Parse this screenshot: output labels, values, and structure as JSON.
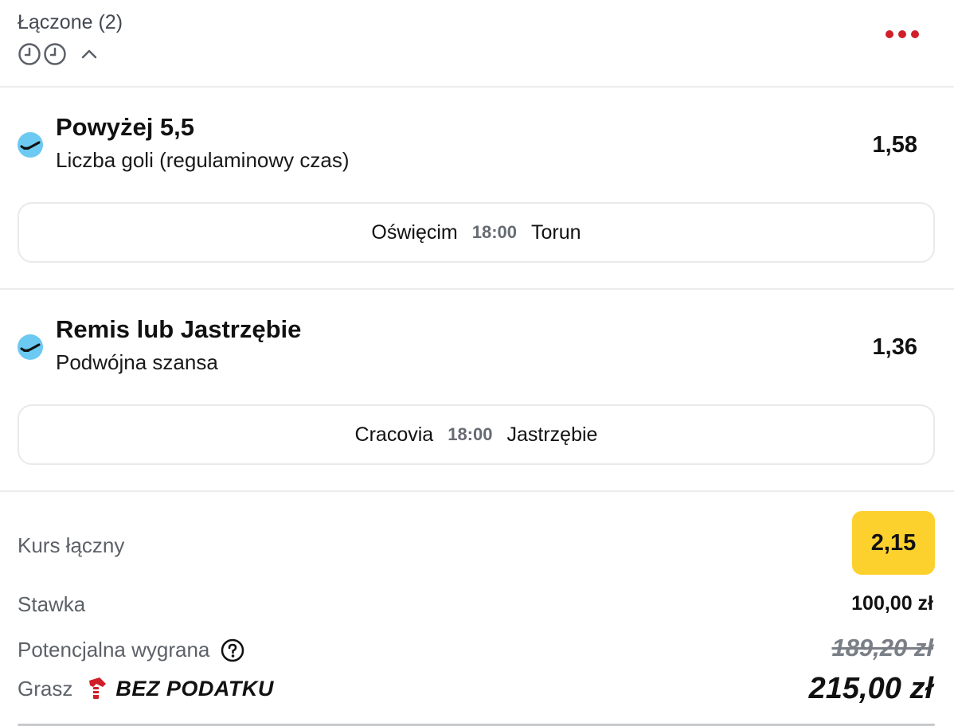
{
  "header": {
    "title": "Łączone (2)",
    "icons": [
      "clock-icon",
      "clock-icon",
      "chevron-up-icon",
      "more-options-icon"
    ]
  },
  "bets": [
    {
      "name": "Powyżej 5,5",
      "market": "Liczba goli (regulaminowy czas)",
      "odds": "1,58",
      "sport_icon": "hockey-icon",
      "home": "Oświęcim",
      "time": "18:00",
      "away": "Torun"
    },
    {
      "name": "Remis lub Jastrzębie",
      "market": "Podwójna szansa",
      "odds": "1,36",
      "sport_icon": "hockey-icon",
      "home": "Cracovia",
      "time": "18:00",
      "away": "Jastrzębie"
    }
  ],
  "summary": {
    "total_odds_label": "Kurs łączny",
    "total_odds": "2,15",
    "stake_label": "Stawka",
    "stake": "100,00 zł",
    "potential_win_label": "Potencjalna wygrana",
    "potential_win_old": "189,20 zł",
    "play_label": "Grasz",
    "tax_free_label": "BEZ PODATKU",
    "potential_win_new": "215,00 zł"
  },
  "colors": {
    "accent_red": "#d11f2a",
    "odds_badge": "#fdd12d",
    "sport_icon_bg": "#6cc9f2"
  }
}
